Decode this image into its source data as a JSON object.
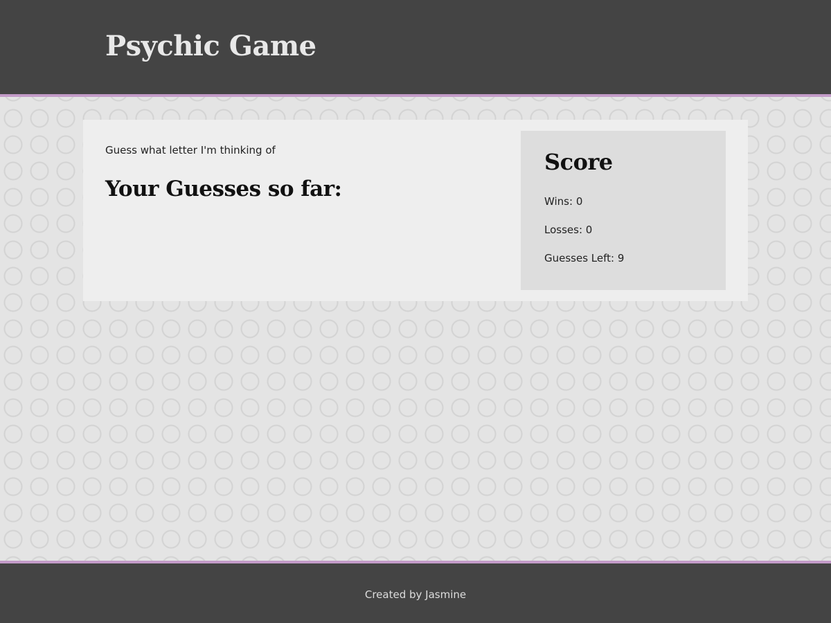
{
  "header": {
    "title": "Psychic Game"
  },
  "game": {
    "instruction": "Guess what letter I'm thinking of",
    "guesses_heading": "Your Guesses so far:",
    "guesses": ""
  },
  "score": {
    "heading": "Score",
    "wins": "Wins: 0",
    "losses": "Losses: 0",
    "guesses_left": "Guesses Left: 9"
  },
  "footer": {
    "credit": "Created by Jasmine"
  },
  "colors": {
    "header_bg": "#444444",
    "accent_border": "#c39bc8",
    "panel_bg": "#eeeeee",
    "score_bg": "#dddddd"
  }
}
